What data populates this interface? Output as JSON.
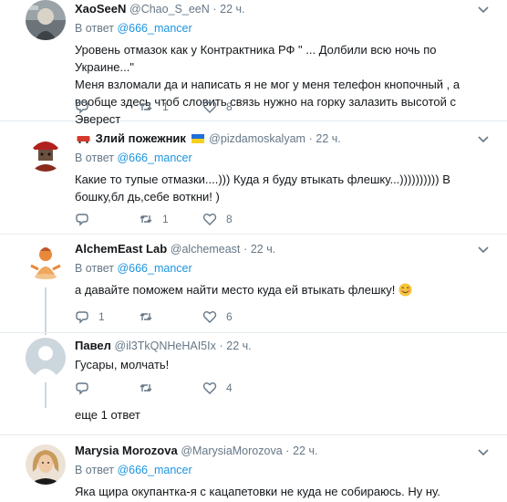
{
  "tweets": [
    {
      "name": "XaoSeeN",
      "handle": "@Chao_S_eeN",
      "time": "22 ч.",
      "reply_prefix": "В ответ",
      "reply_mention": "@666_mancer",
      "text_lines": [
        "Уровень отмазок как у Контрактника РФ \" ... Долбили всю ночь по Украине...\"",
        "Меня взломали да и написать я не мог у меня телефон кнопочный , а",
        "вообще здесь чтоб словить связь нужно на горку залазить высотой с Эверест"
      ],
      "reply_count": "",
      "retweet_count": "1",
      "like_count": "8"
    },
    {
      "name": "Злий пожежник",
      "handle": "@pizdamoskalyam",
      "time": "22 ч.",
      "reply_prefix": "В ответ",
      "reply_mention": "@666_mancer",
      "text_lines": [
        "Какие то тупые отмазки....))) Куда я буду втыкать флешку...)))))))))) В",
        "бошку,бл  дь,себе воткни! )"
      ],
      "reply_count": "",
      "retweet_count": "1",
      "like_count": "8"
    },
    {
      "name": "AlchemEast Lab",
      "handle": "@alchemeast",
      "time": "22 ч.",
      "reply_prefix": "В ответ",
      "reply_mention": "@666_mancer",
      "text_lines": [
        "а давайте поможем найти место куда ей втыкать флешку!"
      ],
      "reply_count": "1",
      "retweet_count": "",
      "like_count": "6"
    },
    {
      "name": "Павел",
      "handle": "@il3TkQNHeHAI5Ix",
      "time": "22 ч.",
      "text_lines": [
        "Гусары, молчать!"
      ],
      "reply_count": "",
      "retweet_count": "",
      "like_count": "4"
    },
    {
      "name": "Marysia Morozova",
      "handle": "@MarysiaMorozova",
      "time": "22 ч.",
      "reply_prefix": "В ответ",
      "reply_mention": "@666_mancer",
      "text_lines": [
        "Яка щира окупантка-я с кацапетовки не куда не собираюсь. Ну ну."
      ]
    }
  ],
  "more_replies_label": "еще 1 ответ",
  "dot": "·",
  "colors": {
    "link": "#1b95e0",
    "secondary": "#657786",
    "border": "#e6ecf0",
    "thread_line": "#ccd6dd"
  },
  "icons": [
    "reply-icon",
    "retweet-icon",
    "like-icon",
    "caret-down-icon",
    "ukraine-flag-icon",
    "smile-emoji-icon"
  ]
}
